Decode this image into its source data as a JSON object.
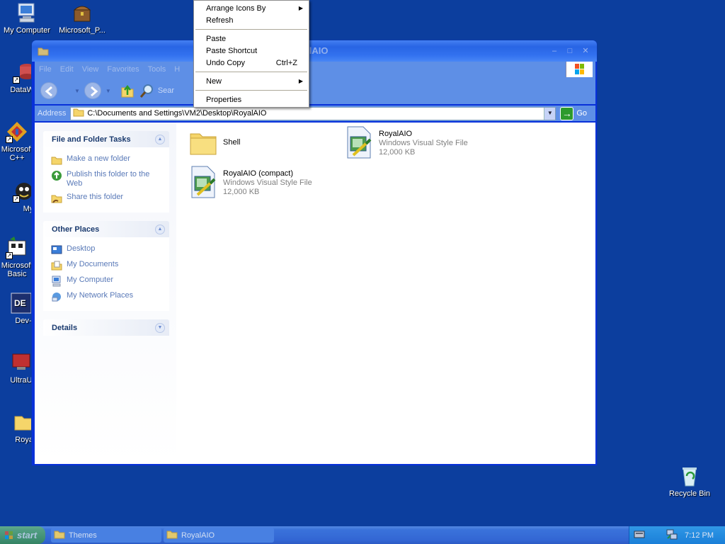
{
  "desktop": {
    "icons": [
      {
        "label": "My Computer"
      },
      {
        "label": "Microsoft_P..."
      },
      {
        "label": "DataWa"
      },
      {
        "label": "Microsoft C++"
      },
      {
        "label": "Myp"
      },
      {
        "label": "Microsoft Basic"
      },
      {
        "label": "Dev-C"
      },
      {
        "label": "UltraUXT"
      },
      {
        "label": "RoyalA"
      }
    ],
    "recycle_bin": "Recycle Bin"
  },
  "window": {
    "title": "RoyalAIO",
    "menu": [
      "File",
      "Edit",
      "View",
      "Favorites",
      "Tools",
      "H"
    ],
    "toolbar": {
      "search": "Sear"
    },
    "address": {
      "label": "Address",
      "value": "C:\\Documents and Settings\\VM2\\Desktop\\RoyalAIO",
      "go": "Go"
    },
    "taskpane": {
      "file_tasks": {
        "title": "File and Folder Tasks",
        "items": [
          "Make a new folder",
          "Publish this folder to the Web",
          "Share this folder"
        ]
      },
      "other_places": {
        "title": "Other Places",
        "items": [
          "Desktop",
          "My Documents",
          "My Computer",
          "My Network Places"
        ]
      },
      "details": {
        "title": "Details"
      }
    },
    "files": [
      {
        "name": "Shell",
        "type": "",
        "size": ""
      },
      {
        "name": "RoyalAIO",
        "type": "Windows Visual Style File",
        "size": "12,000 KB"
      },
      {
        "name": "RoyalAIO (compact)",
        "type": "Windows Visual Style File",
        "size": "12,000 KB"
      }
    ]
  },
  "context_menu": {
    "arrange": "Arrange Icons By",
    "refresh": "Refresh",
    "paste": "Paste",
    "paste_shortcut": "Paste Shortcut",
    "undo": "Undo Copy",
    "undo_accel": "Ctrl+Z",
    "new": "New",
    "properties": "Properties"
  },
  "taskbar": {
    "start": "start",
    "tasks": [
      "Themes",
      "RoyalAIO"
    ],
    "clock": "7:12 PM"
  }
}
